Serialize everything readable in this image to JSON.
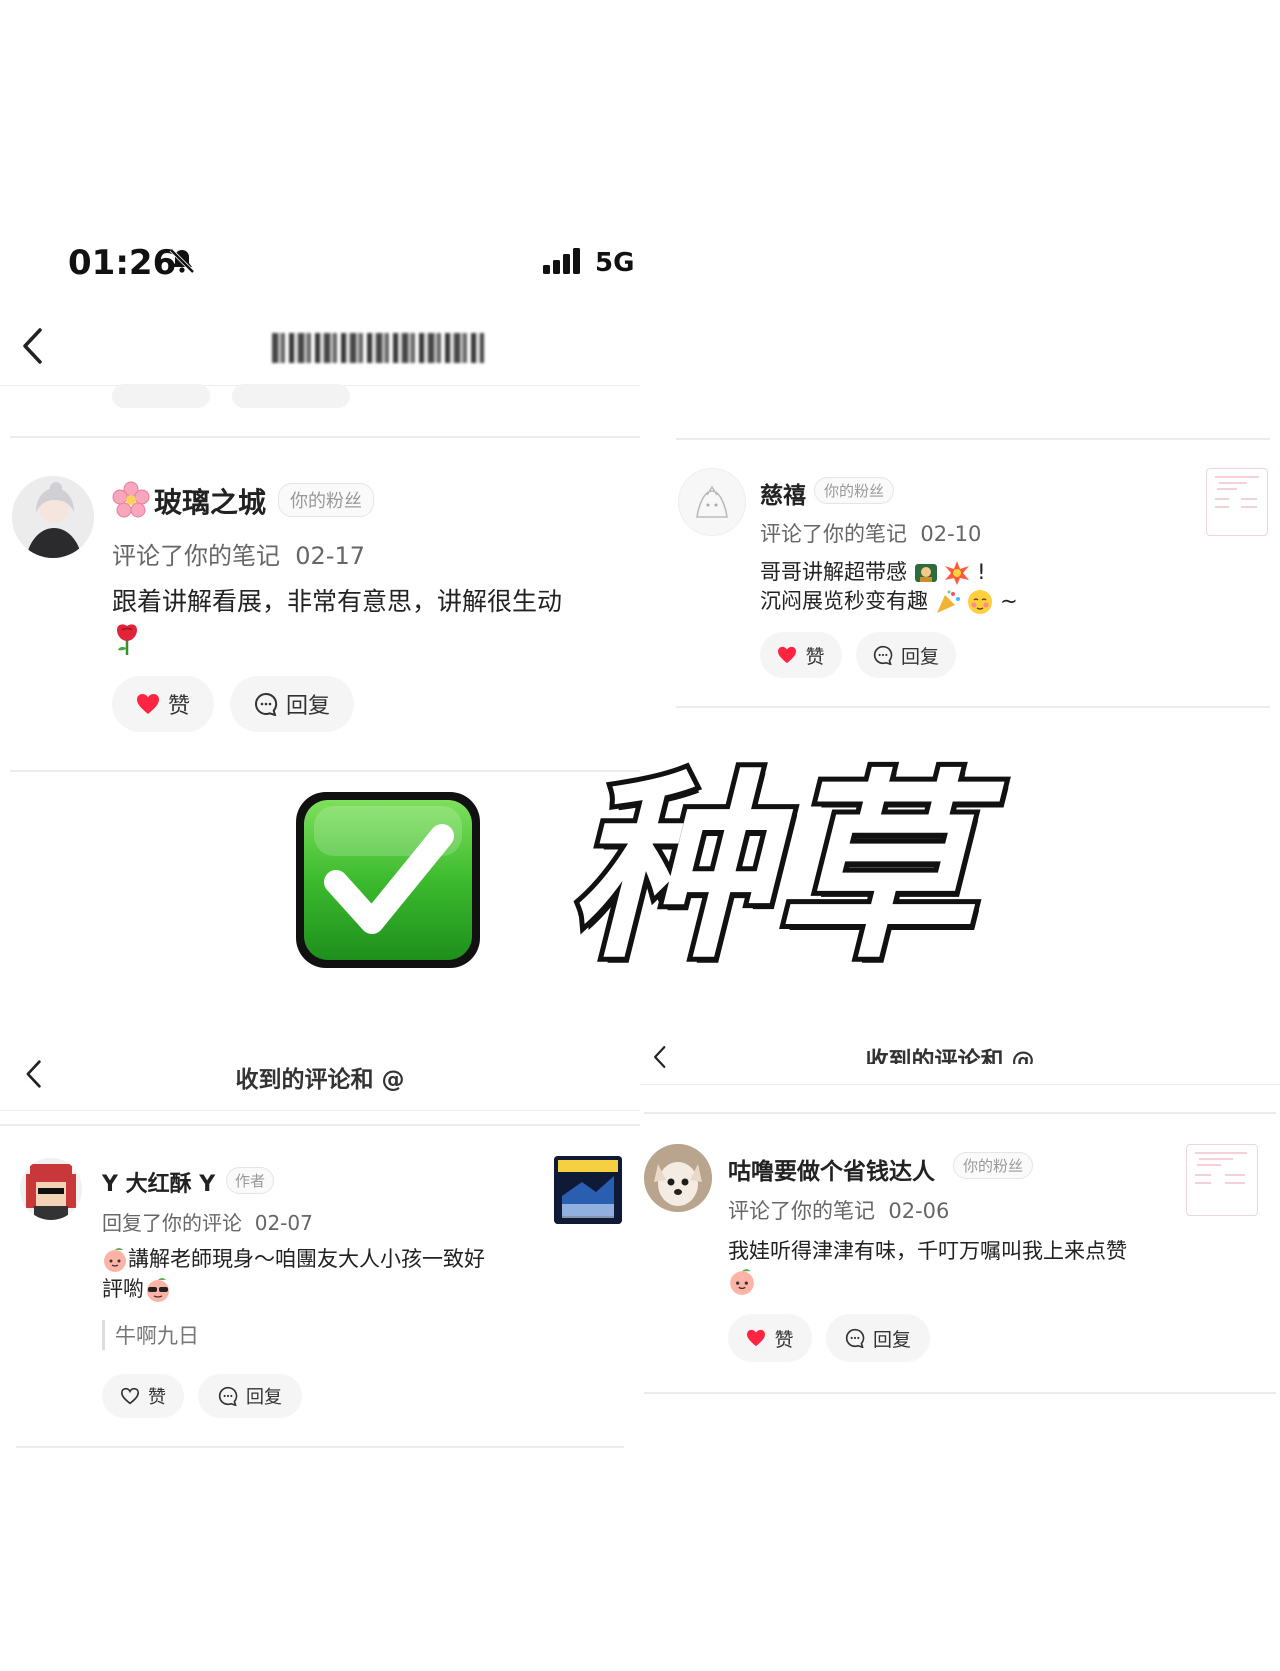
{
  "status_bar": {
    "time": "01:26",
    "network": "5G"
  },
  "banner": {
    "text": "种草"
  },
  "card1": {
    "name": "玻璃之城",
    "badge": "你的粉丝",
    "meta": "评论了你的笔记",
    "date": "02-17",
    "content": "跟着讲解看展，非常有意思，讲解很生动",
    "like_label": "赞",
    "reply_label": "回复"
  },
  "card2": {
    "name": "慈禧",
    "badge": "你的粉丝",
    "meta": "评论了你的笔记",
    "date": "02-10",
    "content_line1": "哥哥讲解超带感",
    "content_line1_end": "!",
    "content_line2": "沉闷展览秒变有趣",
    "content_line2_end": "~",
    "like_label": "赞",
    "reply_label": "回复"
  },
  "screen3": {
    "title": "收到的评论和 @",
    "name": "Y 大红酥 Y",
    "badge": "作者",
    "meta": "回复了你的评论",
    "date": "02-07",
    "content_line1": "講解老師現身～咱團友大人小孩一致好",
    "content_line2": "評喲",
    "quote": "牛啊九日",
    "like_label": "赞",
    "reply_label": "回复"
  },
  "screen4": {
    "title": "收到的评论和 @",
    "name": "咕噜要做个省钱达人",
    "badge": "你的粉丝",
    "meta": "评论了你的笔记",
    "date": "02-06",
    "content": "我娃听得津津有味，千叮万嘱叫我上来点赞",
    "like_label": "赞",
    "reply_label": "回复"
  },
  "colors": {
    "like_red": "#ff2442",
    "check_green": "#3dbb2f",
    "divider": "#ececec"
  }
}
